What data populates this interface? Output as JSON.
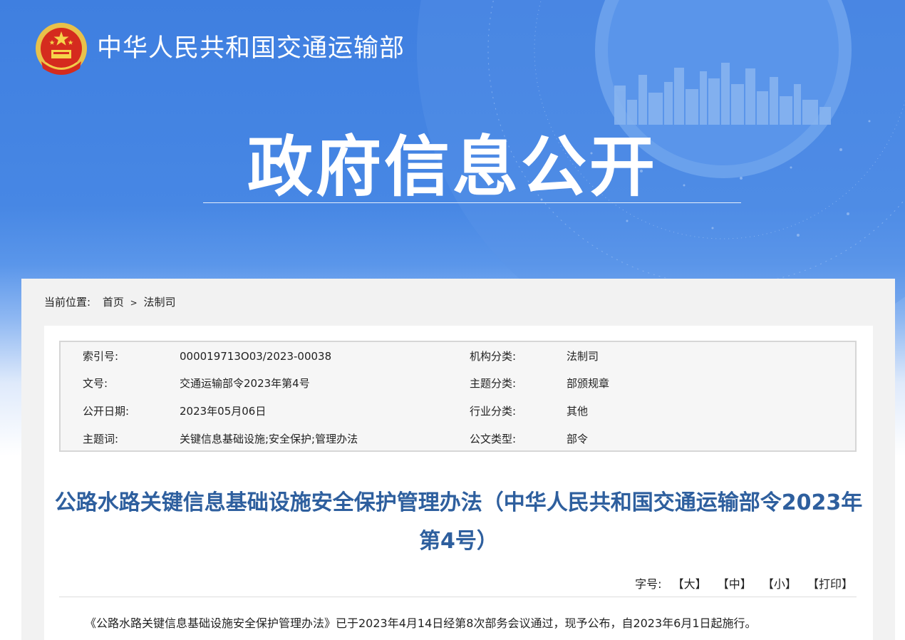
{
  "header": {
    "ministry_name": "中华人民共和国交通运输部",
    "section_title": "政府信息公开"
  },
  "breadcrumb": {
    "prefix": "当前位置:",
    "home": "首页",
    "separator": ">",
    "current": "法制司"
  },
  "meta": {
    "rows": [
      {
        "label1": "索引号:",
        "value1": "000019713O03/2023-00038",
        "label2": "机构分类:",
        "value2": "法制司"
      },
      {
        "label1": "文号:",
        "value1": "交通运输部令2023年第4号",
        "label2": "主题分类:",
        "value2": "部颁规章"
      },
      {
        "label1": "公开日期:",
        "value1": "2023年05月06日",
        "label2": "行业分类:",
        "value2": "其他"
      },
      {
        "label1": "主题词:",
        "value1": "关键信息基础设施;安全保护;管理办法",
        "label2": "公文类型:",
        "value2": "部令"
      }
    ]
  },
  "article": {
    "title": "公路水路关键信息基础设施安全保护管理办法（中华人民共和国交通运输部令2023年第4号）",
    "font_size_label": "字号:",
    "size_large": "【大】",
    "size_medium": "【中】",
    "size_small": "【小】",
    "print": "【打印】",
    "body_first_paragraph": "《公路水路关键信息基础设施安全保护管理办法》已于2023年4月14日经第8次部务会议通过，现予公布，自2023年6月1日起施行。"
  },
  "colors": {
    "banner_blue": "#4787e4",
    "title_blue": "#2e5f9e",
    "panel_gray": "#f2f2f2"
  }
}
